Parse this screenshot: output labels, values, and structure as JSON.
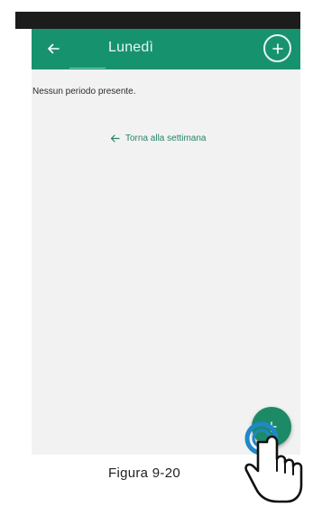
{
  "header": {
    "title": "Lunedì"
  },
  "content": {
    "empty_message": "Nessun periodo presente.",
    "back_to_week_link": "Torna alla settimana"
  },
  "caption": "Figura 9-20",
  "icons": {
    "back": "arrow-left-icon",
    "add": "plus-circle-icon",
    "fab": "plus-icon",
    "tap": "pointing-hand-icon"
  },
  "colors": {
    "primary": "#17926f",
    "fab": "#1c8a66",
    "link": "#27836b",
    "tap_ring": "#1e88c8"
  }
}
